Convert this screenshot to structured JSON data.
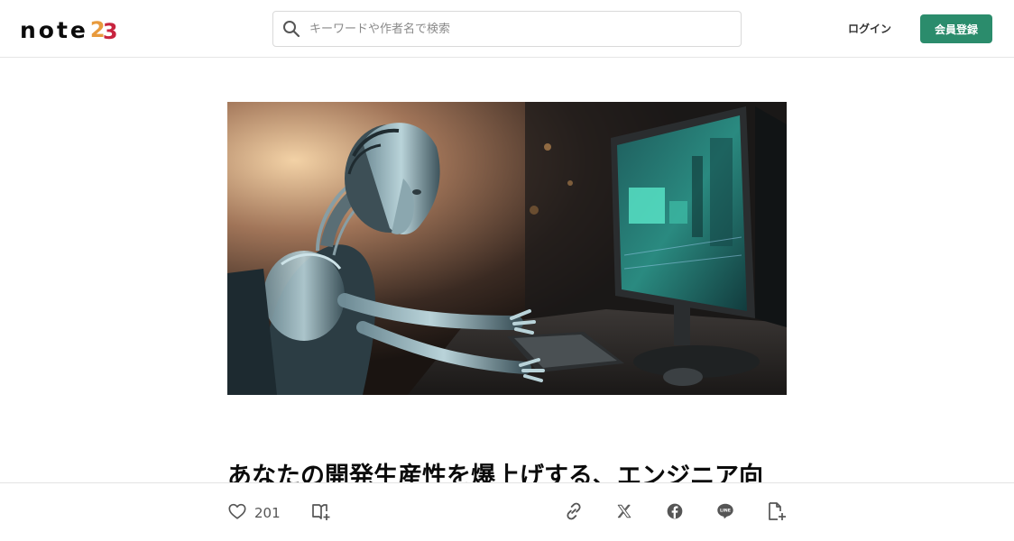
{
  "header": {
    "logo_text": "note",
    "logo_year_digit1": "2",
    "logo_year_digit2": "3",
    "search_placeholder": "キーワードや作者名で検索",
    "login_label": "ログイン",
    "signup_label": "会員登録"
  },
  "article": {
    "title": "あなたの開発生産性を爆上げする、エンジニア向",
    "hero_icon": "robot-at-computer-illustration"
  },
  "actions": {
    "like_count": "201",
    "icons": [
      "heart-icon",
      "magazine-add-icon",
      "link-icon",
      "x-icon",
      "facebook-icon",
      "line-icon",
      "note-add-icon"
    ],
    "line_label": "LINE"
  },
  "colors": {
    "accent": "#2b8c6c",
    "logo_orange": "#e89a3c",
    "logo_red": "#c8243f"
  }
}
